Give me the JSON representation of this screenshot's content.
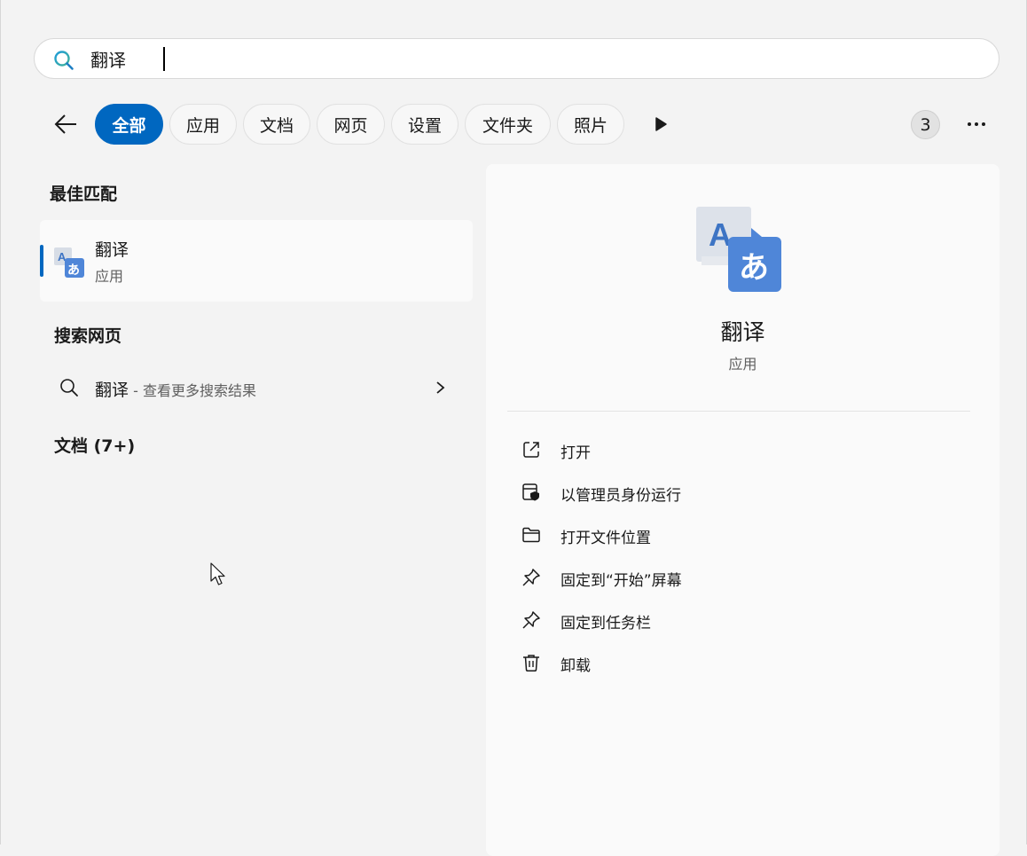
{
  "search": {
    "query": "翻译",
    "placeholder": ""
  },
  "filters": {
    "back_label": "back",
    "chips": [
      "全部",
      "应用",
      "文档",
      "网页",
      "设置",
      "文件夹",
      "照片"
    ],
    "active_index": 0,
    "count_badge": "3"
  },
  "left": {
    "best_match_title": "最佳匹配",
    "best_match": {
      "name": "翻译",
      "type": "应用",
      "icon": "translate-app-icon"
    },
    "web_title": "搜索网页",
    "web_item": {
      "term": "翻译",
      "separator": " - ",
      "hint": "查看更多搜索结果"
    },
    "docs_title": "文档 (7+)"
  },
  "detail": {
    "name": "翻译",
    "type": "应用",
    "actions": [
      {
        "label": "打开",
        "icon": "open-external-icon"
      },
      {
        "label": "以管理员身份运行",
        "icon": "run-as-admin-icon"
      },
      {
        "label": "打开文件位置",
        "icon": "folder-icon"
      },
      {
        "label": "固定到“开始”屏幕",
        "icon": "pin-icon"
      },
      {
        "label": "固定到任务栏",
        "icon": "pin-icon"
      },
      {
        "label": "卸载",
        "icon": "trash-icon"
      }
    ]
  },
  "colors": {
    "accent": "#0067c0",
    "background": "#f3f3f3",
    "panel": "#fafafa"
  }
}
